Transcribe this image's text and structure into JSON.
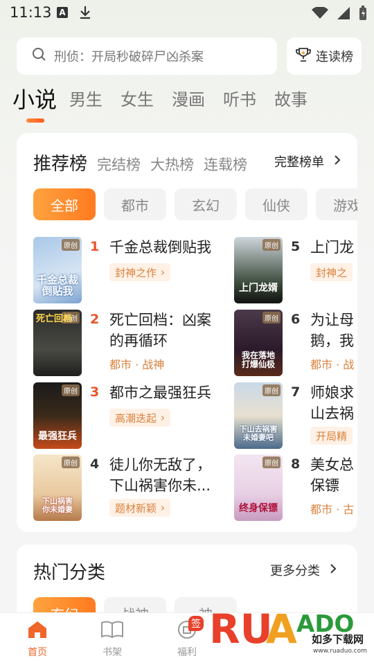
{
  "status": {
    "time": "11:13",
    "a_icon": "A"
  },
  "search": {
    "placeholder": "刑侦：开局秒破碎尸凶杀案",
    "rank_button": "连读榜"
  },
  "categories": [
    "小说",
    "男生",
    "女生",
    "漫画",
    "听书",
    "故事"
  ],
  "ranking": {
    "tabs": [
      "推荐榜",
      "完结榜",
      "大热榜",
      "连载榜"
    ],
    "full_list": "完整榜单",
    "genres": [
      "全部",
      "都市",
      "玄幻",
      "仙侠",
      "游戏"
    ],
    "books": [
      {
        "rank": "1",
        "title_line1": "千金总裁倒贴我",
        "title_line2": "",
        "tag": "封神之作",
        "meta": "",
        "cover_text": "千金总裁\n倒贴我",
        "cover_badge": "原创"
      },
      {
        "rank": "2",
        "title_line1": "死亡回档：凶案",
        "title_line2": "的再循环",
        "tag": "",
        "meta": "都市 · 战神",
        "cover_text": "死亡回档",
        "cover_badge": "原创"
      },
      {
        "rank": "3",
        "title_line1": "都市之最强狂兵",
        "title_line2": "",
        "tag": "高潮迭起",
        "meta": "",
        "cover_text": "最强狂兵",
        "cover_badge": "原创"
      },
      {
        "rank": "4",
        "title_line1": "徒儿你无敌了，",
        "title_line2": "下山祸害你未...",
        "tag": "题材新颖",
        "meta": "",
        "cover_text": "下山祸害\n你未婚妻",
        "cover_badge": "原创"
      },
      {
        "rank": "5",
        "title_line1": "上门龙",
        "title_line2": "",
        "tag": "封神之",
        "meta": "",
        "cover_text": "上门龙婿",
        "cover_badge": "原创"
      },
      {
        "rank": "6",
        "title_line1": "为让母",
        "title_line2": "鹅，我",
        "tag": "",
        "meta": "都市 · 战",
        "cover_text": "我在落地\n打爆仙极",
        "cover_badge": "原创"
      },
      {
        "rank": "7",
        "title_line1": "师娘求",
        "title_line2": "山去祸",
        "tag": "开局精",
        "meta": "",
        "cover_text": "下山去祸害\n未婚妻吧",
        "cover_badge": "原创"
      },
      {
        "rank": "8",
        "title_line1": "美女总",
        "title_line2": "保镖",
        "tag": "",
        "meta": "都市 · 古",
        "cover_text": "终身保镖",
        "cover_badge": "原创"
      }
    ]
  },
  "hot": {
    "title": "热门分类",
    "more": "更多分类",
    "chips": [
      "玄幻",
      "战神",
      "神"
    ]
  },
  "nav": {
    "home": "首页",
    "shelf": "书架",
    "welfare": "福利",
    "badge": "签"
  },
  "watermark": {
    "brand": "RUANDAO",
    "cn": "如多下载网",
    "url": "www.ruaduo.com"
  },
  "colors": {
    "accent": "#ff7a1e",
    "rank_hot": "#e8542a",
    "tag_text": "#d9813b"
  }
}
